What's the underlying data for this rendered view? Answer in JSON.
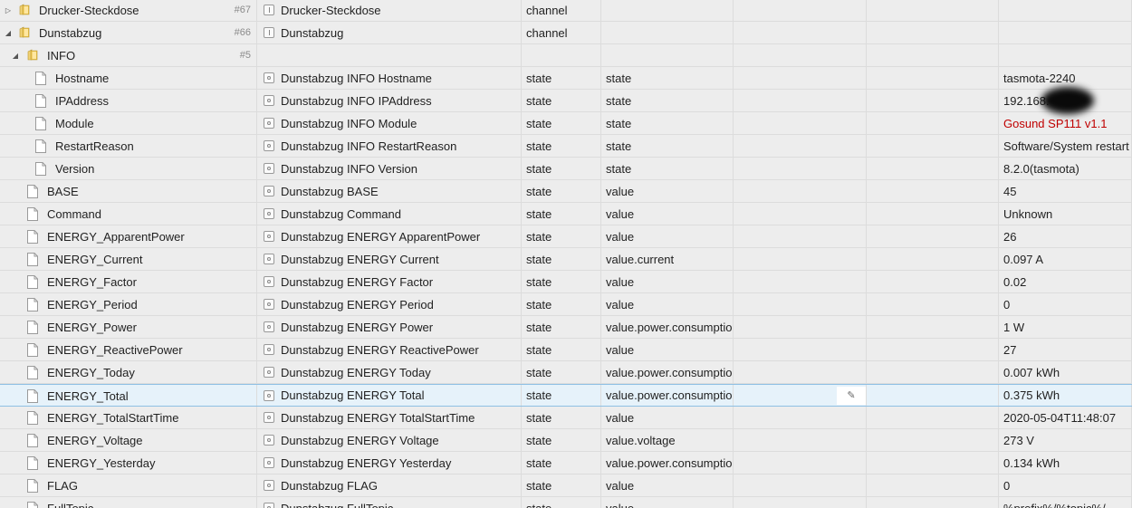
{
  "rows": [
    {
      "id": "Drucker-Steckdose",
      "objid": "#67",
      "name": "Drucker-Steckdose",
      "type": "channel",
      "role": "",
      "value": "",
      "kind": "folder",
      "expanded": false,
      "name_icon": "channel"
    },
    {
      "id": "Dunstabzug",
      "objid": "#66",
      "name": "Dunstabzug",
      "type": "channel",
      "role": "",
      "value": "",
      "kind": "folder",
      "expanded": true,
      "name_icon": "channel"
    },
    {
      "id": "INFO",
      "objid": "#5",
      "name": "",
      "type": "",
      "role": "",
      "value": "",
      "kind": "folder",
      "expanded": true,
      "name_icon": ""
    },
    {
      "id": "Hostname",
      "objid": "",
      "name": "Dunstabzug INFO Hostname",
      "type": "state",
      "role": "state",
      "value": "tasmota-2240",
      "kind": "file-deep"
    },
    {
      "id": "IPAddress",
      "objid": "",
      "name": "Dunstabzug INFO IPAddress",
      "type": "state",
      "role": "state",
      "value": "192.168.",
      "kind": "file-deep"
    },
    {
      "id": "Module",
      "objid": "",
      "name": "Dunstabzug INFO Module",
      "type": "state",
      "role": "state",
      "value": "Gosund SP111 v1.1",
      "kind": "file-deep",
      "value_color": "#c00000"
    },
    {
      "id": "RestartReason",
      "objid": "",
      "name": "Dunstabzug INFO RestartReason",
      "type": "state",
      "role": "state",
      "value": "Software/System restart",
      "kind": "file-deep"
    },
    {
      "id": "Version",
      "objid": "",
      "name": "Dunstabzug INFO Version",
      "type": "state",
      "role": "state",
      "value": "8.2.0(tasmota)",
      "kind": "file-deep"
    },
    {
      "id": "BASE",
      "objid": "",
      "name": "Dunstabzug BASE",
      "type": "state",
      "role": "value",
      "value": "45",
      "kind": "file"
    },
    {
      "id": "Command",
      "objid": "",
      "name": "Dunstabzug Command",
      "type": "state",
      "role": "value",
      "value": "Unknown",
      "kind": "file"
    },
    {
      "id": "ENERGY_ApparentPower",
      "objid": "",
      "name": "Dunstabzug ENERGY ApparentPower",
      "type": "state",
      "role": "value",
      "value": "26",
      "kind": "file"
    },
    {
      "id": "ENERGY_Current",
      "objid": "",
      "name": "Dunstabzug ENERGY Current",
      "type": "state",
      "role": "value.current",
      "value": "0.097 A",
      "kind": "file"
    },
    {
      "id": "ENERGY_Factor",
      "objid": "",
      "name": "Dunstabzug ENERGY Factor",
      "type": "state",
      "role": "value",
      "value": "0.02",
      "kind": "file"
    },
    {
      "id": "ENERGY_Period",
      "objid": "",
      "name": "Dunstabzug ENERGY Period",
      "type": "state",
      "role": "value",
      "value": "0",
      "kind": "file"
    },
    {
      "id": "ENERGY_Power",
      "objid": "",
      "name": "Dunstabzug ENERGY Power",
      "type": "state",
      "role": "value.power.consumptio",
      "value": "1 W",
      "kind": "file"
    },
    {
      "id": "ENERGY_ReactivePower",
      "objid": "",
      "name": "Dunstabzug ENERGY ReactivePower",
      "type": "state",
      "role": "value",
      "value": "27",
      "kind": "file"
    },
    {
      "id": "ENERGY_Today",
      "objid": "",
      "name": "Dunstabzug ENERGY Today",
      "type": "state",
      "role": "value.power.consumptio",
      "value": "0.007 kWh",
      "kind": "file"
    },
    {
      "id": "ENERGY_Total",
      "objid": "",
      "name": "Dunstabzug ENERGY Total",
      "type": "state",
      "role": "value.power.consumptio",
      "value": "0.375 kWh",
      "kind": "file",
      "selected": true
    },
    {
      "id": "ENERGY_TotalStartTime",
      "objid": "",
      "name": "Dunstabzug ENERGY TotalStartTime",
      "type": "state",
      "role": "value",
      "value": "2020-05-04T11:48:07",
      "kind": "file"
    },
    {
      "id": "ENERGY_Voltage",
      "objid": "",
      "name": "Dunstabzug ENERGY Voltage",
      "type": "state",
      "role": "value.voltage",
      "value": "273 V",
      "kind": "file"
    },
    {
      "id": "ENERGY_Yesterday",
      "objid": "",
      "name": "Dunstabzug ENERGY Yesterday",
      "type": "state",
      "role": "value.power.consumptio",
      "value": "0.134 kWh",
      "kind": "file"
    },
    {
      "id": "FLAG",
      "objid": "",
      "name": "Dunstabzug FLAG",
      "type": "state",
      "role": "value",
      "value": "0",
      "kind": "file"
    },
    {
      "id": "FullTopic",
      "objid": "",
      "name": "Dunstabzug FullTopic",
      "type": "state",
      "role": "value",
      "value": "%prefix%/%topic%/",
      "kind": "file"
    }
  ],
  "icons": {
    "folder": "folder-icon",
    "file": "file-icon",
    "state": "state-icon",
    "channel": "channel-icon",
    "edit": "pencil-icon",
    "expand": "triangle-right-icon",
    "collapse": "triangle-down-icon"
  },
  "colors": {
    "selected_bg": "#e6f2fa",
    "alarm_text": "#c00000",
    "folder": "#e8c04a"
  }
}
